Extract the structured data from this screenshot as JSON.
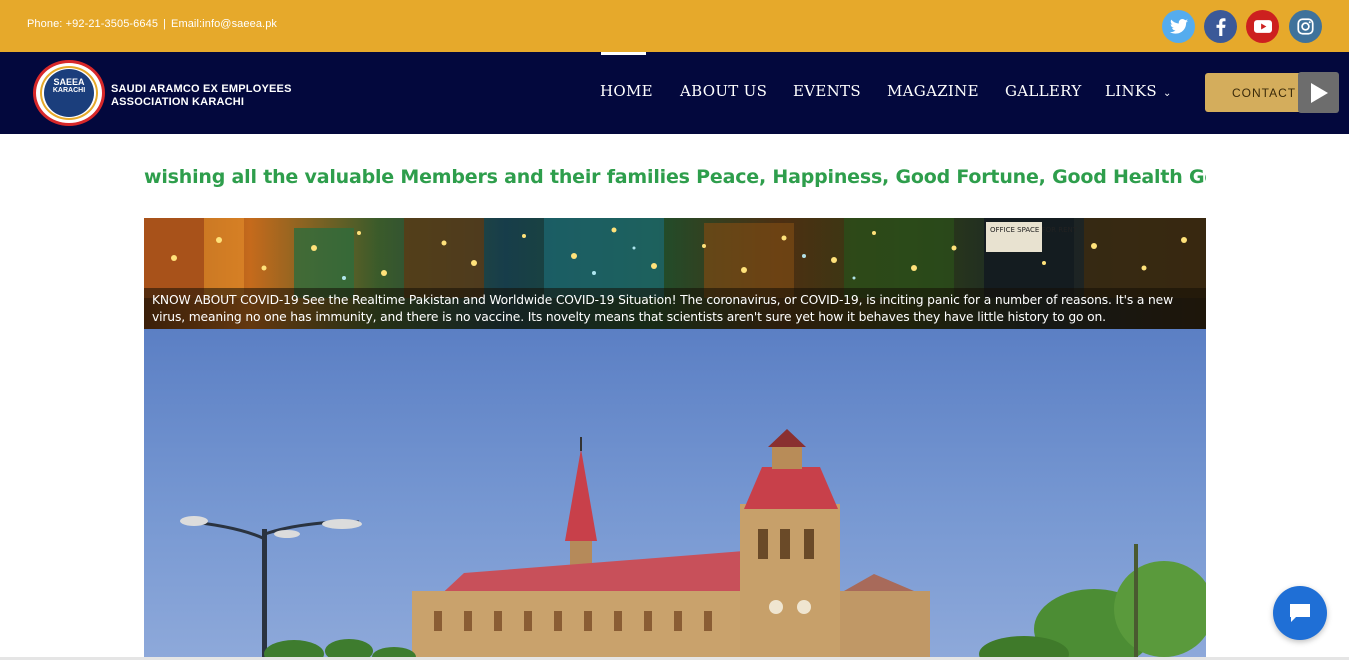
{
  "topbar": {
    "phone": "Phone: +92-21-3505-6645",
    "separator": "|",
    "email": "Email:info@saeea.pk",
    "social": [
      "twitter-icon",
      "facebook-icon",
      "youtube-icon",
      "instagram-icon"
    ],
    "bg_color": "#e6a92b"
  },
  "brand": {
    "logo_line1": "SAEEA",
    "logo_line2": "KARACHI",
    "name_line1": "SAUDI ARAMCO EX EMPLOYEES",
    "name_line2": "ASSOCIATION KARACHI"
  },
  "nav": {
    "items": [
      {
        "label": "HOME",
        "active": true
      },
      {
        "label": "ABOUT US"
      },
      {
        "label": "EVENTS"
      },
      {
        "label": "MAGAZINE"
      },
      {
        "label": "GALLERY"
      },
      {
        "label": "LINKS"
      }
    ],
    "contact_label": "CONTACT",
    "bg_color": "#03083d"
  },
  "marquee": {
    "text": "wishing all the valuable Members and their families Peace, Happiness, Good Fortune, Good Health Good Lu"
  },
  "banner": {
    "caption": "KNOW ABOUT COVID-19 See the Realtime Pakistan and Worldwide COVID-19 Situation! The coronavirus, or COVID-19, is inciting panic for a number of reasons. It's a new virus, meaning no one has immunity, and there is no vaccine. Its novelty means that scientists aren't sure yet how it behaves they have little history to go on.",
    "sign_text": "OFFICE SPACE FOR RENT"
  }
}
